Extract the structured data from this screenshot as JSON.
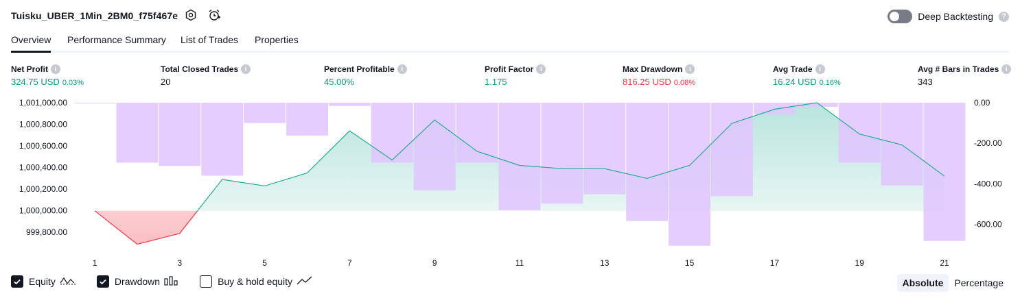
{
  "header": {
    "strategy_name": "Tuisku_UBER_1Min_2BM0_f75f467e",
    "deep_backtesting_label": "Deep Backtesting",
    "deep_backtesting_enabled": false
  },
  "tabs": [
    {
      "label": "Overview",
      "active": true
    },
    {
      "label": "Performance Summary",
      "active": false
    },
    {
      "label": "List of Trades",
      "active": false
    },
    {
      "label": "Properties",
      "active": false
    }
  ],
  "stats": [
    {
      "label": "Net Profit",
      "value": "324.75 USD",
      "pct": "0.03%",
      "color": "#089981"
    },
    {
      "label": "Total Closed Trades",
      "value": "20",
      "pct": "",
      "color": "#131722"
    },
    {
      "label": "Percent Profitable",
      "value": "45.00%",
      "pct": "",
      "color": "#089981"
    },
    {
      "label": "Profit Factor",
      "value": "1.175",
      "pct": "",
      "color": "#089981"
    },
    {
      "label": "Max Drawdown",
      "value": "816.25 USD",
      "pct": "0.08%",
      "color": "#f23645"
    },
    {
      "label": "Avg Trade",
      "value": "16.24 USD",
      "pct": "0.16%",
      "color": "#089981"
    },
    {
      "label": "Avg # Bars in Trades",
      "value": "343",
      "pct": "",
      "color": "#131722"
    }
  ],
  "chart_data": {
    "type": "line",
    "x": [
      1,
      2,
      3,
      4,
      5,
      6,
      7,
      8,
      9,
      10,
      11,
      12,
      13,
      14,
      15,
      16,
      17,
      18,
      19,
      20,
      21
    ],
    "x_tick_labels": [
      "1",
      "3",
      "5",
      "7",
      "9",
      "11",
      "13",
      "15",
      "17",
      "19",
      "21"
    ],
    "series": [
      {
        "role": "equity",
        "axis": "left",
        "color": "#22ab94",
        "values": [
          1000000,
          999690,
          999790,
          1000290,
          1000230,
          1000350,
          1000740,
          1000470,
          1000840,
          1000550,
          1000420,
          1000390,
          1000390,
          1000300,
          1000420,
          1000810,
          1000940,
          1001000,
          1000710,
          1000610,
          1000320
        ]
      },
      {
        "role": "drawdown",
        "axis": "right",
        "color": "#e1c4ff",
        "values": [
          0,
          -296,
          -312,
          -360,
          -100,
          -162,
          -16,
          -296,
          -432,
          -296,
          -530,
          -498,
          -452,
          -584,
          -706,
          -462,
          -58,
          -20,
          -296,
          -408,
          -682
        ]
      }
    ],
    "left_axis": {
      "ticks": [
        "1,001,000.00",
        "1,000,800.00",
        "1,000,600.00",
        "1,000,400.00",
        "1,000,200.00",
        "1,000,000.00",
        "999,800.00"
      ],
      "range": [
        999700,
        1001000
      ]
    },
    "right_axis": {
      "ticks": [
        "0.00",
        "-200.00",
        "-400.00",
        "-600.00"
      ],
      "range": [
        -710,
        0
      ]
    },
    "baseline": 1000000
  },
  "legend": {
    "items": [
      {
        "label": "Equity",
        "checked": true,
        "glyph": "equity-glyph-icon"
      },
      {
        "label": "Drawdown",
        "checked": true,
        "glyph": "drawdown-glyph-icon"
      },
      {
        "label": "Buy & hold equity",
        "checked": false,
        "glyph": "buyhold-glyph-icon"
      }
    ],
    "modes": [
      {
        "label": "Absolute",
        "active": true
      },
      {
        "label": "Percentage",
        "active": false
      }
    ]
  }
}
